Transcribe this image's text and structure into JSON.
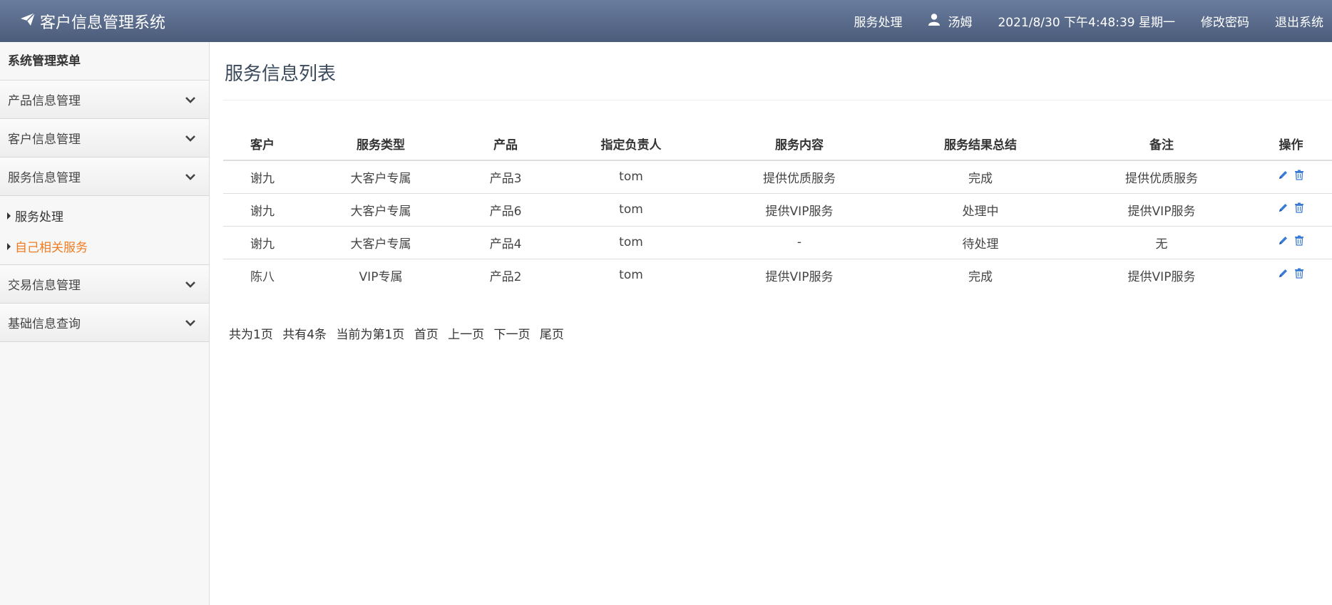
{
  "app": {
    "title": "客户信息管理系统"
  },
  "topnav": {
    "service": "服务处理",
    "user": "汤姆",
    "datetime": "2021/8/30 下午4:48:39 星期一",
    "change_password": "修改密码",
    "logout": "退出系统"
  },
  "sidebar": {
    "header": "系统管理菜单",
    "groups": [
      {
        "label": "产品信息管理"
      },
      {
        "label": "客户信息管理"
      },
      {
        "label": "服务信息管理",
        "items": [
          {
            "label": "服务处理"
          },
          {
            "label": "自己相关服务"
          }
        ]
      },
      {
        "label": "交易信息管理"
      },
      {
        "label": "基础信息查询"
      }
    ]
  },
  "main": {
    "title": "服务信息列表",
    "columns": [
      "客户",
      "服务类型",
      "产品",
      "指定负责人",
      "服务内容",
      "服务结果总结",
      "备注",
      "操作"
    ],
    "rows": [
      [
        "谢九",
        "大客户专属",
        "产品3",
        "tom",
        "提供优质服务",
        "完成",
        "提供优质服务"
      ],
      [
        "谢九",
        "大客户专属",
        "产品6",
        "tom",
        "提供VIP服务",
        "处理中",
        "提供VIP服务"
      ],
      [
        "谢九",
        "大客户专属",
        "产品4",
        "tom",
        "-",
        "待处理",
        "无"
      ],
      [
        "陈八",
        "VIP专属",
        "产品2",
        "tom",
        "提供VIP服务",
        "完成",
        "提供VIP服务"
      ]
    ]
  },
  "pager": {
    "total_pages": "共为1页",
    "total_items": "共有4条",
    "current": "当前为第1页",
    "first": "首页",
    "prev": "上一页",
    "next": "下一页",
    "last": "尾页"
  },
  "colors": {
    "topbar": "#56678a",
    "active": "#ef7c22",
    "icon": "#3a7bd5"
  }
}
